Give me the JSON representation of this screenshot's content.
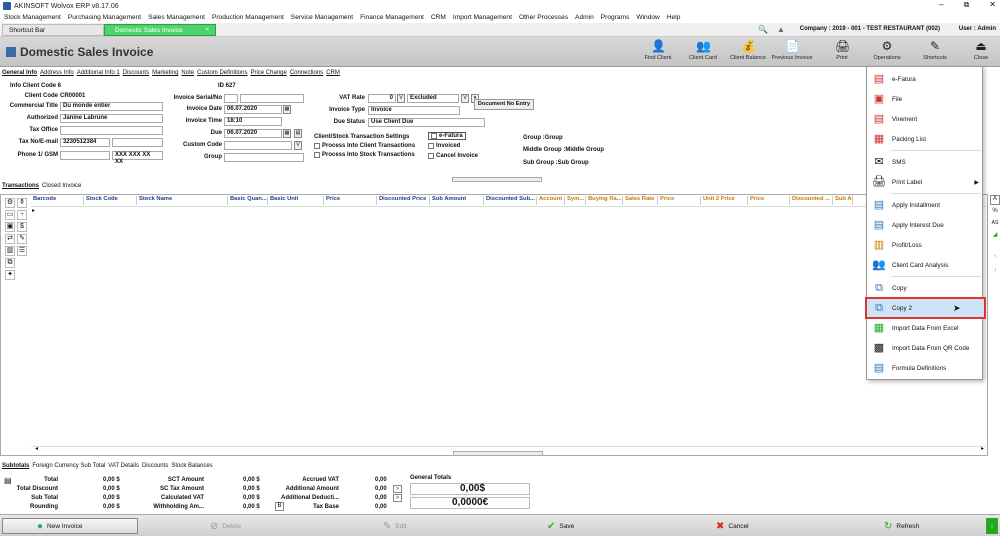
{
  "window": {
    "title": "AKINSOFT Wolvox ERP v8.17.06",
    "controls": [
      "–",
      "⧉",
      "✕"
    ]
  },
  "menu": [
    "Stock Management",
    "Purchasing Management",
    "Sales Management",
    "Production Management",
    "Service Management",
    "Finance Management",
    "CRM",
    "Import Management",
    "Other Processes",
    "Admin",
    "Programs",
    "Window",
    "Help"
  ],
  "tabs": [
    {
      "label": "Shortcut Bar"
    },
    {
      "label": "Domestic Sales Invoice",
      "close": "×"
    }
  ],
  "company": "Company : 2019 - 001 - TEST RESTAURANT (002)",
  "user": "User : Admin",
  "header": {
    "title": "Domestic Sales Invoice",
    "toolbar": [
      {
        "label": "Find Client",
        "icon": "find-client-icon"
      },
      {
        "label": "Client Card",
        "icon": "client-card-icon"
      },
      {
        "label": "Client Balance",
        "icon": "client-balance-icon"
      },
      {
        "label": "Previous Invoice",
        "icon": "previous-invoice-icon"
      },
      {
        "label": "Print",
        "icon": "print-icon"
      },
      {
        "label": "Operations",
        "icon": "operations-icon"
      },
      {
        "label": "Shortcuts",
        "icon": "shortcuts-icon"
      },
      {
        "label": "Close",
        "icon": "close-icon"
      }
    ]
  },
  "subtabs": [
    "General Info",
    "Address Info",
    "Additional Info 1",
    "Discounts",
    "Marketing",
    "Note",
    "Custom Definitions",
    "Price Change",
    "Connections",
    "CRM"
  ],
  "form": {
    "info_client_code_label": "Info Client Code 6",
    "id_label": "ID 627",
    "client_code_label": "Client Code",
    "client_code": "CR00001",
    "commercial_title_label": "Commercial Title",
    "commercial_title": "Du monde entier",
    "authorized_label": "Authorized",
    "authorized": "Janine Labrune",
    "tax_office_label": "Tax Office",
    "tax_no_label": "Tax No/E-mail",
    "tax_no": "3230512384",
    "phone_label": "Phone 1/ GSM",
    "phone2": "XXX XXX XX XX",
    "invoice_serial_label": "Invoice Serial/No",
    "invoice_date_label": "Invoice Date",
    "invoice_date": "06.07.2020",
    "invoice_time_label": "Invoice Time",
    "invoice_time": "18:10",
    "due_label": "Due",
    "due": "06.07.2020",
    "custom_code_label": "Custom Code",
    "group_label": "Group",
    "vat_rate_label": "VAT Rate",
    "vat_rate": "0",
    "vat_excluded": "Excluded",
    "invoice_type_label": "Invoice Type",
    "invoice_type": "Invoice",
    "due_status_label": "Due Status",
    "due_status": "Use Client Due",
    "document_no_entry": "Document No Entry",
    "settings_title": "Client/Stock Transaction Settings",
    "process_client": "Process Into Client Transactions",
    "process_stock": "Process Into Stock Transactions",
    "efatura": "e-Fatura",
    "invoiced": "Invoiced",
    "cancel_invoice": "Cancel Invoice",
    "group_text": "Group :Group",
    "middle_group": "Middle Group :Middle Group",
    "sub_group": "Sub Group :Sub Group"
  },
  "trans_tabs": [
    "Transactions",
    "Closed Invoice"
  ],
  "grid_columns": [
    "Barcode",
    "Stock Code",
    "Stock Name",
    "Basic Quan...",
    "Basic Unit",
    "Price",
    "Discounted Price",
    "Sub Amount",
    "Discounted Sub...",
    "Account",
    "Sym...",
    "Buying Ra...",
    "Sales Rate",
    "Price",
    "Unit 2 Price",
    "Price",
    "Discounted ...",
    "Sub Ar"
  ],
  "sub_tabs": [
    "Subtotals",
    "Foreign Currency Sub Total",
    "VAT Details",
    "Discounts",
    "Stock Balances"
  ],
  "totals": {
    "total_label": "Total",
    "total": "0,00 $",
    "total_discount_label": "Total Discount",
    "total_discount": "0,00 $",
    "sub_total_label": "Sub Total",
    "sub_total": "0,00 $",
    "rounding_label": "Rounding",
    "rounding": "0,00 $",
    "sct_amount_label": "SCT Amount",
    "sct_amount": "0,00 $",
    "sct_tax_label": "SC Tax Amount",
    "sct_tax": "0,00 $",
    "calc_vat_label": "Calculated VAT",
    "calc_vat": "0,00 $",
    "withholding_label": "Withholding Am...",
    "withholding": "0,00 $",
    "accrued_vat_label": "Accrued VAT",
    "accrued_vat": "0,00",
    "additional_amount_label": "Additional Amount",
    "additional_amount": "0,00",
    "additional_deduct_label": "Additional Deducti...",
    "additional_deduct": "0,00",
    "tax_base_label": "Tax Base",
    "tax_base": "0,00",
    "general_totals_label": "General Totals",
    "general_total_usd": "0,00$",
    "general_total_eur": "0,0000€"
  },
  "bottom": {
    "new_invoice": "New Invoice",
    "delete": "Delete",
    "edit": "Edit",
    "save": "Save",
    "cancel": "Cancel",
    "refresh": "Refresh"
  },
  "popup_menu": [
    {
      "label": "e-Fatura",
      "icon": "efatura-icon"
    },
    {
      "label": "File",
      "icon": "file-icon"
    },
    {
      "label": "Virement",
      "icon": "virement-icon"
    },
    {
      "label": "Packing List",
      "icon": "packing-list-icon"
    },
    {
      "label": "SMS",
      "icon": "sms-icon"
    },
    {
      "label": "Print Label",
      "icon": "print-label-icon"
    },
    {
      "label": "Apply Installment",
      "icon": "installment-icon"
    },
    {
      "label": "Apply Interest Due",
      "icon": "interest-icon"
    },
    {
      "label": "Profit/Loss",
      "icon": "profit-loss-icon"
    },
    {
      "label": "Client Card Analysis",
      "icon": "analysis-icon"
    },
    {
      "label": "Copy",
      "icon": "copy-icon"
    },
    {
      "label": "Copy 2",
      "icon": "copy2-icon"
    },
    {
      "label": "Import Data From Excel",
      "icon": "excel-icon"
    },
    {
      "label": "Import Data From QR Code",
      "icon": "qr-icon"
    },
    {
      "label": "Formula Definitions",
      "icon": "formula-icon"
    }
  ]
}
